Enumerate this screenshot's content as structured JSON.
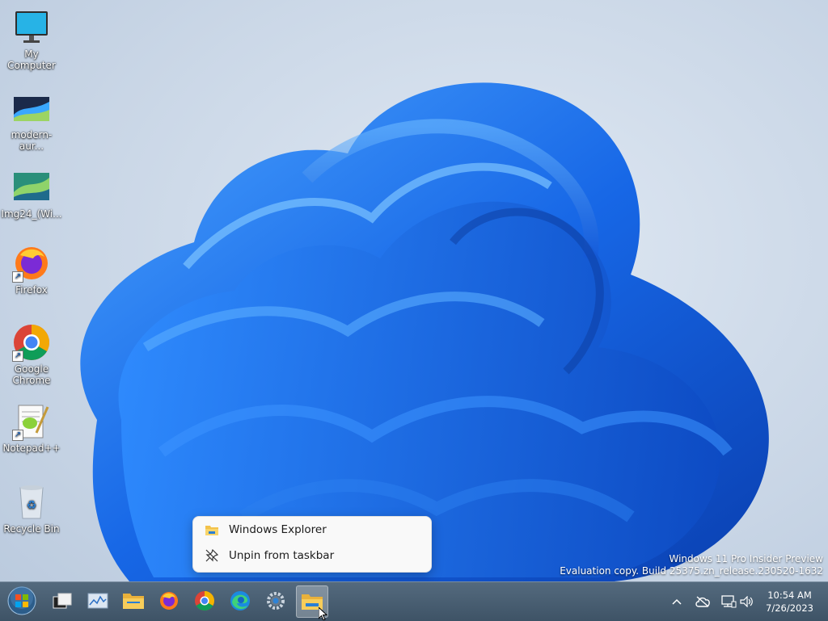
{
  "desktop": {
    "icons": [
      {
        "label": "My Computer"
      },
      {
        "label": "modern-aur..."
      },
      {
        "label": "Img24_(Wi..."
      },
      {
        "label": "Firefox"
      },
      {
        "label": "Google Chrome"
      },
      {
        "label": "Notepad++"
      },
      {
        "label": "Recycle Bin"
      }
    ]
  },
  "context_menu": {
    "items": [
      {
        "label": "Windows Explorer",
        "icon": "folder-icon"
      },
      {
        "label": "Unpin from taskbar",
        "icon": "unpin-icon"
      }
    ]
  },
  "watermark": {
    "line1": "Windows 11 Pro Insider Preview",
    "line2": "Evaluation copy. Build 25375.zn_release.230520-1632"
  },
  "taskbar": {
    "apps": [
      "start-orb-icon",
      "task-view-icon",
      "task-manager-icon",
      "file-explorer-icon",
      "firefox-icon",
      "chrome-icon",
      "edge-icon",
      "settings-icon",
      "windows-explorer-icon"
    ],
    "active_app": "windows-explorer-icon"
  },
  "tray": {
    "clock_time": "10:54 AM",
    "clock_date": "7/26/2023"
  },
  "colors": {
    "wallpaper_bloom": "#1a6de8",
    "taskbar": "#455b6f",
    "menu_bg": "#f9f9f9"
  }
}
